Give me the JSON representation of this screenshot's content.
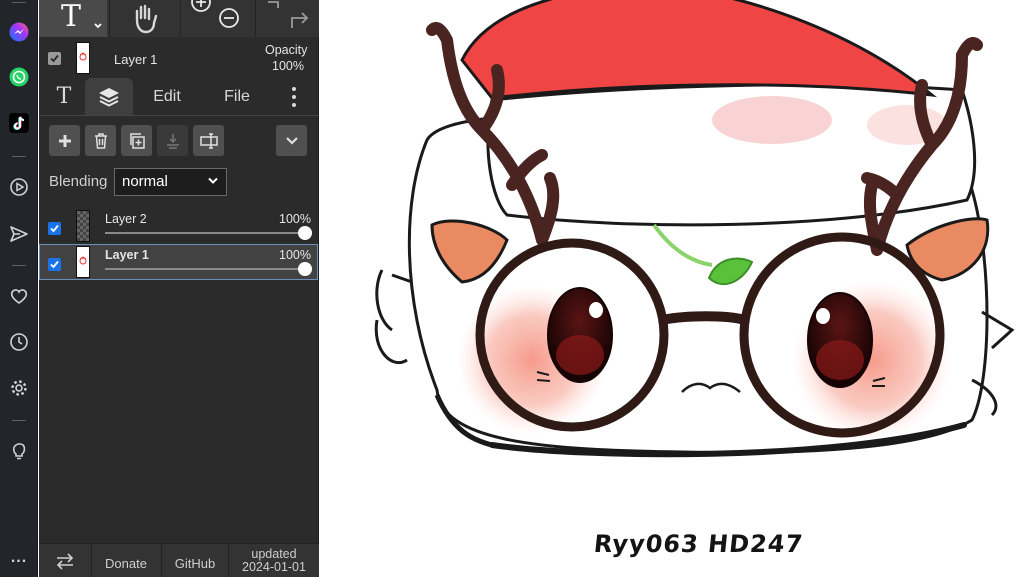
{
  "dock": {
    "items": [
      {
        "name": "messenger-icon"
      },
      {
        "name": "whatsapp-icon"
      },
      {
        "name": "tiktok-icon"
      },
      {
        "name": "play-circle-icon"
      },
      {
        "name": "send-icon"
      },
      {
        "name": "heart-icon"
      },
      {
        "name": "clock-icon"
      },
      {
        "name": "gear-icon"
      },
      {
        "name": "lightbulb-icon"
      },
      {
        "name": "more-icon"
      }
    ],
    "more_label": "..."
  },
  "layer_info": {
    "name": "Layer 1",
    "opacity_label": "Opacity",
    "opacity_value": "100%"
  },
  "tabs": {
    "text_tab": "T",
    "edit": "Edit",
    "file": "File"
  },
  "blending": {
    "label": "Blending",
    "value": "normal"
  },
  "layers": [
    {
      "name": "Layer 2",
      "opacity": "100%",
      "opacity_fraction": 1.0,
      "selected": false
    },
    {
      "name": "Layer 1",
      "opacity": "100%",
      "opacity_fraction": 1.0,
      "selected": true
    }
  ],
  "bottom": {
    "donate": "Donate",
    "github": "GitHub",
    "updated_label": "updated",
    "updated_date": "2024-01-01"
  },
  "canvas": {
    "signature": "Ryy063 HD247"
  },
  "colors": {
    "accent": "#1a73e8",
    "panel_bg": "#2b2b2b",
    "hat_red": "#f04545",
    "antler": "#4a2420",
    "ear": "#e98a62",
    "blush": "#f7a697"
  }
}
